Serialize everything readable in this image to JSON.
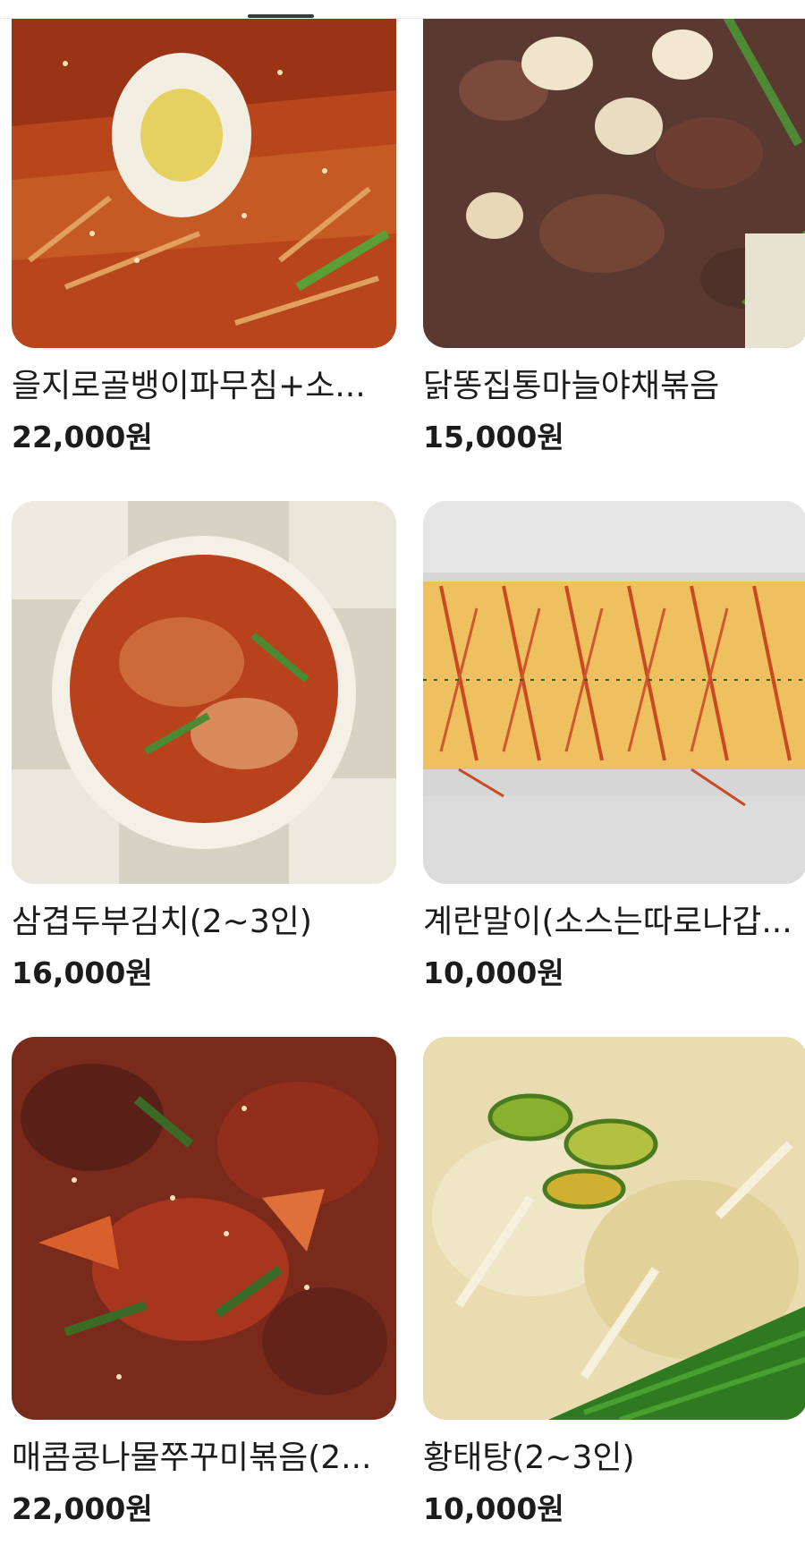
{
  "products": [
    {
      "title": "을지로골뱅이파무침+소...",
      "price": "22,000원",
      "image": "spicy-sea-snail-salad-with-egg"
    },
    {
      "title": "닭똥집통마늘야채볶음",
      "price": "15,000원",
      "image": "stir-fried-gizzard-garlic"
    },
    {
      "title": "삼겹두부김치(2~3인)",
      "price": "16,000원",
      "image": "pork-kimchi-with-tofu"
    },
    {
      "title": "계란말이(소스는따로나갑...",
      "price": "10,000원",
      "image": "rolled-omelette-ketchup"
    },
    {
      "title": "매콤콩나물쭈꾸미볶음(2...",
      "price": "22,000원",
      "image": "spicy-webfoot-octopus"
    },
    {
      "title": "황태탕(2~3인)",
      "price": "10,000원",
      "image": "dried-pollack-soup"
    }
  ],
  "colors": {
    "text": "#1c1c1c",
    "background": "#ffffff",
    "indicator": "#3a3a3a"
  }
}
